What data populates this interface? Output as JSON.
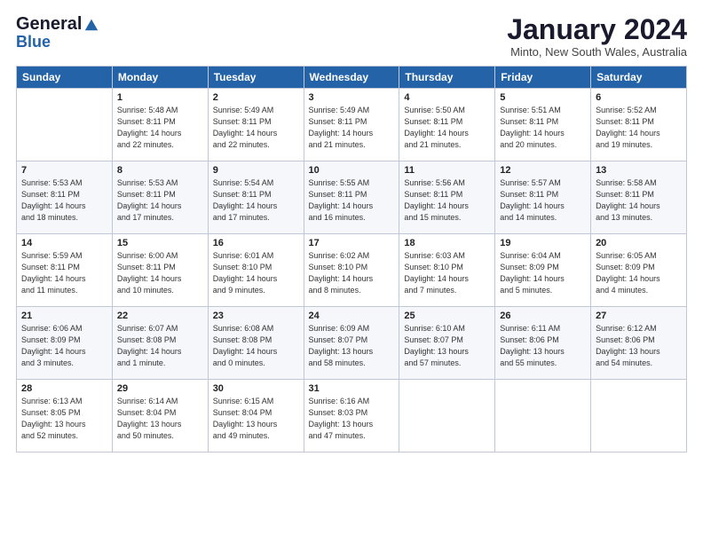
{
  "header": {
    "logo_line1": "General",
    "logo_line2": "Blue",
    "month_title": "January 2024",
    "subtitle": "Minto, New South Wales, Australia"
  },
  "days_of_week": [
    "Sunday",
    "Monday",
    "Tuesday",
    "Wednesday",
    "Thursday",
    "Friday",
    "Saturday"
  ],
  "weeks": [
    [
      {
        "day": "",
        "info": ""
      },
      {
        "day": "1",
        "info": "Sunrise: 5:48 AM\nSunset: 8:11 PM\nDaylight: 14 hours\nand 22 minutes."
      },
      {
        "day": "2",
        "info": "Sunrise: 5:49 AM\nSunset: 8:11 PM\nDaylight: 14 hours\nand 22 minutes."
      },
      {
        "day": "3",
        "info": "Sunrise: 5:49 AM\nSunset: 8:11 PM\nDaylight: 14 hours\nand 21 minutes."
      },
      {
        "day": "4",
        "info": "Sunrise: 5:50 AM\nSunset: 8:11 PM\nDaylight: 14 hours\nand 21 minutes."
      },
      {
        "day": "5",
        "info": "Sunrise: 5:51 AM\nSunset: 8:11 PM\nDaylight: 14 hours\nand 20 minutes."
      },
      {
        "day": "6",
        "info": "Sunrise: 5:52 AM\nSunset: 8:11 PM\nDaylight: 14 hours\nand 19 minutes."
      }
    ],
    [
      {
        "day": "7",
        "info": "Sunrise: 5:53 AM\nSunset: 8:11 PM\nDaylight: 14 hours\nand 18 minutes."
      },
      {
        "day": "8",
        "info": "Sunrise: 5:53 AM\nSunset: 8:11 PM\nDaylight: 14 hours\nand 17 minutes."
      },
      {
        "day": "9",
        "info": "Sunrise: 5:54 AM\nSunset: 8:11 PM\nDaylight: 14 hours\nand 17 minutes."
      },
      {
        "day": "10",
        "info": "Sunrise: 5:55 AM\nSunset: 8:11 PM\nDaylight: 14 hours\nand 16 minutes."
      },
      {
        "day": "11",
        "info": "Sunrise: 5:56 AM\nSunset: 8:11 PM\nDaylight: 14 hours\nand 15 minutes."
      },
      {
        "day": "12",
        "info": "Sunrise: 5:57 AM\nSunset: 8:11 PM\nDaylight: 14 hours\nand 14 minutes."
      },
      {
        "day": "13",
        "info": "Sunrise: 5:58 AM\nSunset: 8:11 PM\nDaylight: 14 hours\nand 13 minutes."
      }
    ],
    [
      {
        "day": "14",
        "info": "Sunrise: 5:59 AM\nSunset: 8:11 PM\nDaylight: 14 hours\nand 11 minutes."
      },
      {
        "day": "15",
        "info": "Sunrise: 6:00 AM\nSunset: 8:11 PM\nDaylight: 14 hours\nand 10 minutes."
      },
      {
        "day": "16",
        "info": "Sunrise: 6:01 AM\nSunset: 8:10 PM\nDaylight: 14 hours\nand 9 minutes."
      },
      {
        "day": "17",
        "info": "Sunrise: 6:02 AM\nSunset: 8:10 PM\nDaylight: 14 hours\nand 8 minutes."
      },
      {
        "day": "18",
        "info": "Sunrise: 6:03 AM\nSunset: 8:10 PM\nDaylight: 14 hours\nand 7 minutes."
      },
      {
        "day": "19",
        "info": "Sunrise: 6:04 AM\nSunset: 8:09 PM\nDaylight: 14 hours\nand 5 minutes."
      },
      {
        "day": "20",
        "info": "Sunrise: 6:05 AM\nSunset: 8:09 PM\nDaylight: 14 hours\nand 4 minutes."
      }
    ],
    [
      {
        "day": "21",
        "info": "Sunrise: 6:06 AM\nSunset: 8:09 PM\nDaylight: 14 hours\nand 3 minutes."
      },
      {
        "day": "22",
        "info": "Sunrise: 6:07 AM\nSunset: 8:08 PM\nDaylight: 14 hours\nand 1 minute."
      },
      {
        "day": "23",
        "info": "Sunrise: 6:08 AM\nSunset: 8:08 PM\nDaylight: 14 hours\nand 0 minutes."
      },
      {
        "day": "24",
        "info": "Sunrise: 6:09 AM\nSunset: 8:07 PM\nDaylight: 13 hours\nand 58 minutes."
      },
      {
        "day": "25",
        "info": "Sunrise: 6:10 AM\nSunset: 8:07 PM\nDaylight: 13 hours\nand 57 minutes."
      },
      {
        "day": "26",
        "info": "Sunrise: 6:11 AM\nSunset: 8:06 PM\nDaylight: 13 hours\nand 55 minutes."
      },
      {
        "day": "27",
        "info": "Sunrise: 6:12 AM\nSunset: 8:06 PM\nDaylight: 13 hours\nand 54 minutes."
      }
    ],
    [
      {
        "day": "28",
        "info": "Sunrise: 6:13 AM\nSunset: 8:05 PM\nDaylight: 13 hours\nand 52 minutes."
      },
      {
        "day": "29",
        "info": "Sunrise: 6:14 AM\nSunset: 8:04 PM\nDaylight: 13 hours\nand 50 minutes."
      },
      {
        "day": "30",
        "info": "Sunrise: 6:15 AM\nSunset: 8:04 PM\nDaylight: 13 hours\nand 49 minutes."
      },
      {
        "day": "31",
        "info": "Sunrise: 6:16 AM\nSunset: 8:03 PM\nDaylight: 13 hours\nand 47 minutes."
      },
      {
        "day": "",
        "info": ""
      },
      {
        "day": "",
        "info": ""
      },
      {
        "day": "",
        "info": ""
      }
    ]
  ]
}
